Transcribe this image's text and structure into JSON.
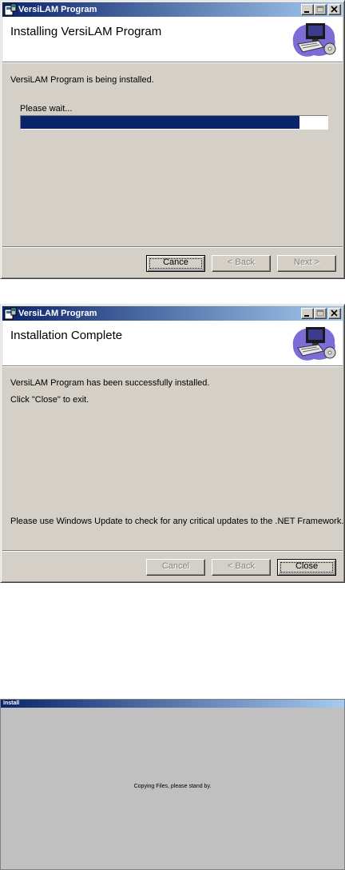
{
  "window1": {
    "title": "VersiLAM Program",
    "header_title": "Installing VersiLAM Program",
    "status": "VersiLAM Program is being installed.",
    "please_wait": "Please wait...",
    "progress_percent": 91,
    "buttons": {
      "cancel": "Cance",
      "back": "< Back",
      "next": "Next >"
    }
  },
  "window2": {
    "title": "VersiLAM Program",
    "header_title": "Installation Complete",
    "success": "VersiLAM Program has been successfully installed.",
    "click_close": "Click \"Close\" to exit.",
    "update_note": "Please use Windows Update to check for any critical updates to the .NET Framework.",
    "buttons": {
      "cancel": "Cancel",
      "back": "< Back",
      "close": "Close"
    }
  },
  "window3": {
    "title": "Install",
    "message": "Copying Files, please stand by."
  },
  "colors": {
    "titlebar_start": "#0a246a",
    "titlebar_end": "#a6caf0",
    "face": "#d4d0c8",
    "progress": "#0a246a"
  },
  "icons": [
    "app-icon",
    "minimize-icon",
    "maximize-icon",
    "close-icon",
    "computer-installer-icon"
  ]
}
